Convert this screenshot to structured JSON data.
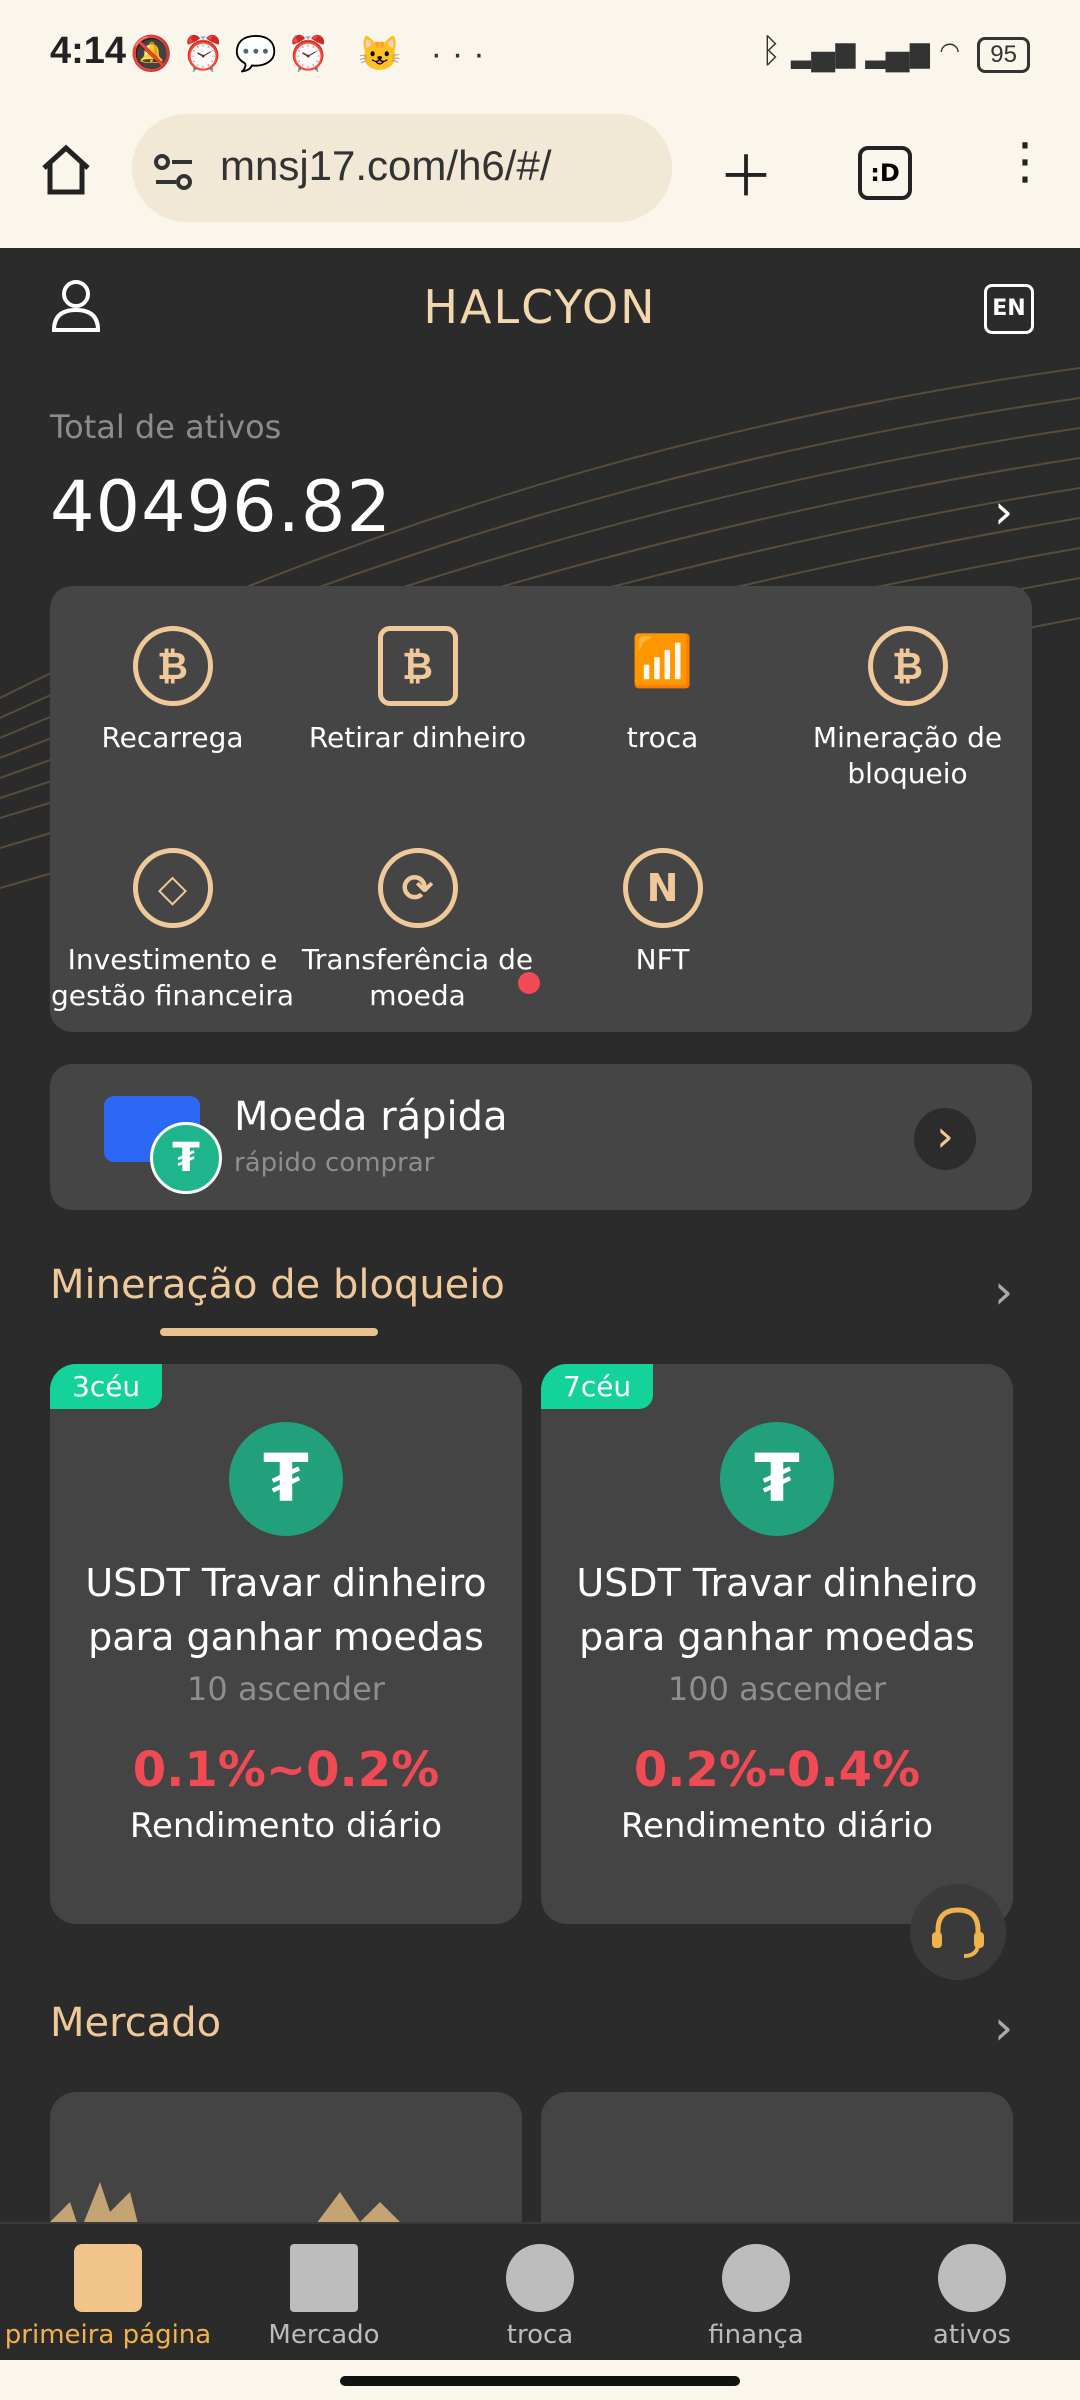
{
  "status": {
    "time": "4:14",
    "battery": "95"
  },
  "browser": {
    "url": "mnsj17.com/h6/#/"
  },
  "header": {
    "title": "HALCYON",
    "lang": "EN"
  },
  "assets": {
    "label": "Total de ativos",
    "value": "40496.82"
  },
  "grid": [
    {
      "label": "Recarrega",
      "icon": "bitcoin-refresh-icon"
    },
    {
      "label": "Retirar dinheiro",
      "icon": "bitcoin-withdraw-icon"
    },
    {
      "label": "troca",
      "icon": "chart-up-icon"
    },
    {
      "label": "Mineração de bloqueio",
      "icon": "bitcoin-hand-icon"
    },
    {
      "label": "Investimento e gestão financeira",
      "icon": "diamond-coin-icon"
    },
    {
      "label": "Transferência de moeda",
      "icon": "coin-transfer-icon"
    },
    {
      "label": "NFT",
      "icon": "nft-icon"
    }
  ],
  "quick": {
    "title": "Moeda rápida",
    "subtitle": "rápido comprar"
  },
  "mining": {
    "section_title": "Mineração de bloqueio",
    "cards": [
      {
        "tag": "3céu",
        "title": "USDT Travar dinheiro para ganhar moedas",
        "min": "10 ascender",
        "rate": "0.1%~0.2%",
        "rate_label": "Rendimento diário"
      },
      {
        "tag": "7céu",
        "title": "USDT Travar dinheiro para ganhar moedas",
        "min": "100 ascender",
        "rate": "0.2%-0.4%",
        "rate_label": "Rendimento diário"
      }
    ]
  },
  "market": {
    "section_title": "Mercado"
  },
  "nav": [
    {
      "label": "primeira página",
      "icon": "home-icon"
    },
    {
      "label": "Mercado",
      "icon": "bars-icon"
    },
    {
      "label": "troca",
      "icon": "exchange-icon"
    },
    {
      "label": "finança",
      "icon": "finance-icon"
    },
    {
      "label": "ativos",
      "icon": "pie-icon"
    }
  ],
  "colors": {
    "accent": "#f0c99a",
    "rate": "#f04a55",
    "tag": "#13d39b"
  }
}
